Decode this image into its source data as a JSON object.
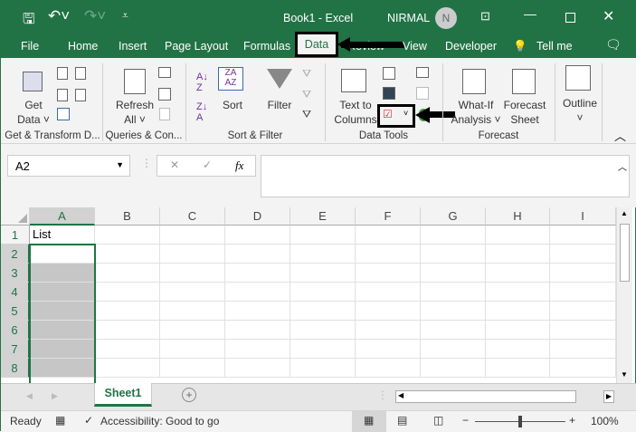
{
  "title": {
    "doc": "Book1  -  Excel",
    "user": "NIRMAL",
    "avatar": "N"
  },
  "menu": [
    "File",
    "Home",
    "Insert",
    "Page Layout",
    "Formulas",
    "Data",
    "Review",
    "View",
    "Developer",
    "Tell me"
  ],
  "ribbon": {
    "get_data": [
      "Get",
      "Data ˅"
    ],
    "refresh": [
      "Refresh",
      "All ˅"
    ],
    "sort": "Sort",
    "filter": "Filter",
    "text_to_columns": [
      "Text to",
      "Columns"
    ],
    "what_if": [
      "What-If",
      "Analysis ˅"
    ],
    "forecast_sheet": [
      "Forecast",
      "Sheet"
    ],
    "outline": "Outline",
    "groups": [
      "Get & Transform D...",
      "Queries & Con...",
      "Sort & Filter",
      "Data Tools",
      "Forecast"
    ]
  },
  "formula_bar": {
    "name_box": "A2",
    "fx": "fx",
    "value": ""
  },
  "columns": [
    "A",
    "B",
    "C",
    "D",
    "E",
    "F",
    "G",
    "H",
    "I"
  ],
  "rows": [
    "1",
    "2",
    "3",
    "4",
    "5",
    "6",
    "7",
    "8"
  ],
  "cells": {
    "A1": "List"
  },
  "sheet": {
    "tab": "Sheet1"
  },
  "status": {
    "ready": "Ready",
    "accessibility": "Accessibility: Good to go",
    "zoom": "100%"
  },
  "colors": {
    "accent": "#217346",
    "selection": "#c6c6c6"
  }
}
